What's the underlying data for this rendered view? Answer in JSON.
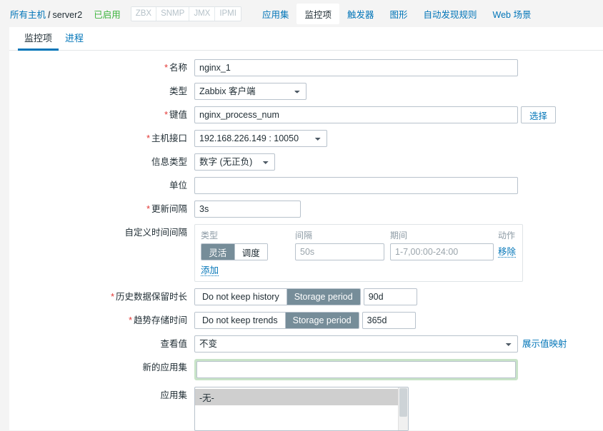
{
  "header": {
    "breadcrumb_root": "所有主机",
    "breadcrumb_sep": "/",
    "breadcrumb_current": "server2",
    "status": "已启用",
    "interfaces": [
      "ZBX",
      "SNMP",
      "JMX",
      "IPMI"
    ],
    "nav_tabs": [
      {
        "label": "应用集",
        "active": false
      },
      {
        "label": "监控项",
        "active": true
      },
      {
        "label": "触发器",
        "active": false
      },
      {
        "label": "图形",
        "active": false
      },
      {
        "label": "自动发现规则",
        "active": false
      },
      {
        "label": "Web 场景",
        "active": false
      }
    ]
  },
  "subtabs": [
    {
      "label": "监控项",
      "active": true
    },
    {
      "label": "进程",
      "active": false
    }
  ],
  "form": {
    "name": {
      "label": "名称",
      "required": true,
      "value": "nginx_1"
    },
    "type": {
      "label": "类型",
      "required": false,
      "value": "Zabbix 客户端"
    },
    "key": {
      "label": "键值",
      "required": true,
      "value": "nginx_process_num",
      "button": "选择"
    },
    "host_interface": {
      "label": "主机接口",
      "required": true,
      "value": "192.168.226.149 : 10050"
    },
    "info_type": {
      "label": "信息类型",
      "required": false,
      "value": "数字 (无正负)"
    },
    "units": {
      "label": "单位",
      "required": false,
      "value": ""
    },
    "update_interval": {
      "label": "更新间隔",
      "required": true,
      "value": "3s"
    },
    "custom_intervals": {
      "label": "自定义时间间隔",
      "columns": {
        "type": "类型",
        "interval": "间隔",
        "period": "期间",
        "action": "动作"
      },
      "rows": [
        {
          "toggle": {
            "options": [
              "灵活",
              "调度"
            ],
            "selected": "灵活"
          },
          "interval_value": "",
          "interval_placeholder": "50s",
          "period_value": "",
          "period_placeholder": "1-7,00:00-24:00",
          "action": "移除"
        }
      ],
      "add_label": "添加"
    },
    "history": {
      "label": "历史数据保留时长",
      "required": true,
      "options": [
        "Do not keep history",
        "Storage period"
      ],
      "selected": "Storage period",
      "value": "90d"
    },
    "trends": {
      "label": "趋势存储时间",
      "required": true,
      "options": [
        "Do not keep trends",
        "Storage period"
      ],
      "selected": "Storage period",
      "value": "365d"
    },
    "view_value": {
      "label": "查看值",
      "required": false,
      "value": "不变",
      "mapping_link": "展示值映射"
    },
    "new_application": {
      "label": "新的应用集",
      "required": false,
      "value": "",
      "focused": true
    },
    "applications": {
      "label": "应用集",
      "required": false,
      "options": [
        {
          "label": "-无-",
          "selected": true
        }
      ]
    }
  },
  "colors": {
    "accent": "#0275b8",
    "enabled": "#3db43d",
    "required": "#e33734",
    "toggle_selected": "#768d99",
    "focus_ring": "#c8e3c8"
  }
}
